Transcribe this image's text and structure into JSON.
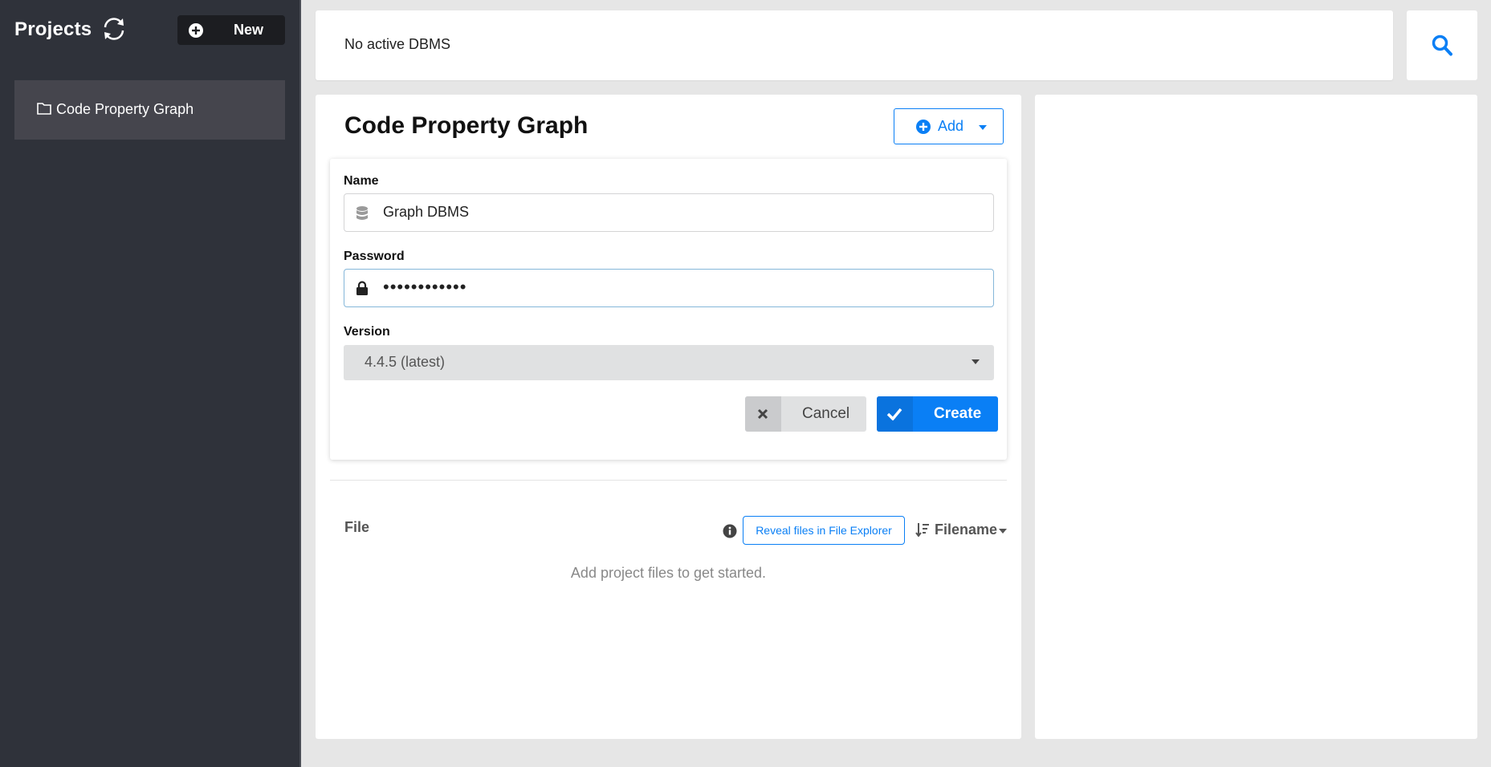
{
  "sidebar": {
    "title": "Projects",
    "refresh_icon": "refresh-icon",
    "new_button_label": "New",
    "projects": [
      {
        "label": "Code Property Graph",
        "icon": "folder-icon"
      }
    ]
  },
  "topbar": {
    "status": "No active DBMS",
    "search_icon": "search-icon"
  },
  "project": {
    "title": "Code Property Graph",
    "add_button_label": "Add"
  },
  "form": {
    "name_label": "Name",
    "name_value": "Graph DBMS",
    "password_label": "Password",
    "password_value": "••••••••••••",
    "version_label": "Version",
    "version_value": "4.4.5 (latest)",
    "cancel_label": "Cancel",
    "create_label": "Create"
  },
  "files": {
    "header": "File",
    "reveal_label": "Reveal files in File Explorer",
    "sort_label": "Filename",
    "empty_message": "Add project files to get started."
  },
  "colors": {
    "accent": "#0a7ff5",
    "sidebar_bg": "#2f323a",
    "sidebar_item_bg": "#45454d"
  }
}
